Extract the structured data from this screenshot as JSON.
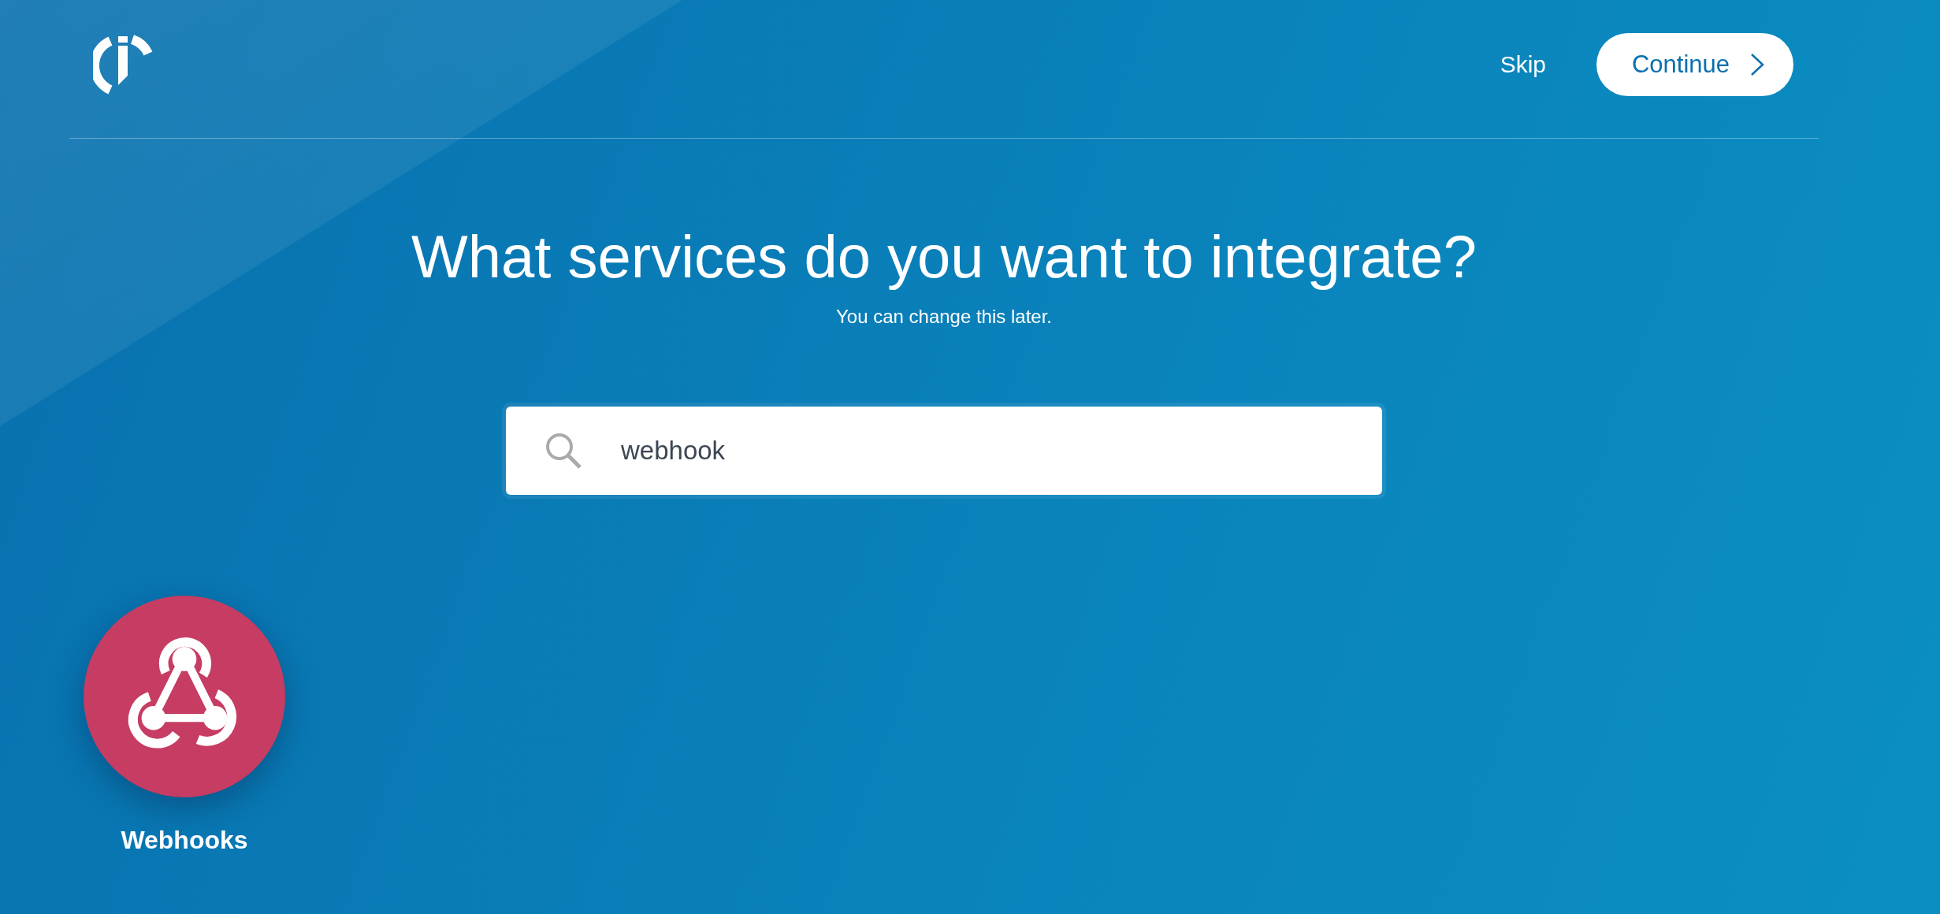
{
  "header": {
    "skip": "Skip",
    "continue": "Continue"
  },
  "heading": "What services do you want to integrate?",
  "subheading": "You can change this later.",
  "search": {
    "value": "webhook"
  },
  "results": [
    {
      "name": "Webhooks"
    }
  ]
}
